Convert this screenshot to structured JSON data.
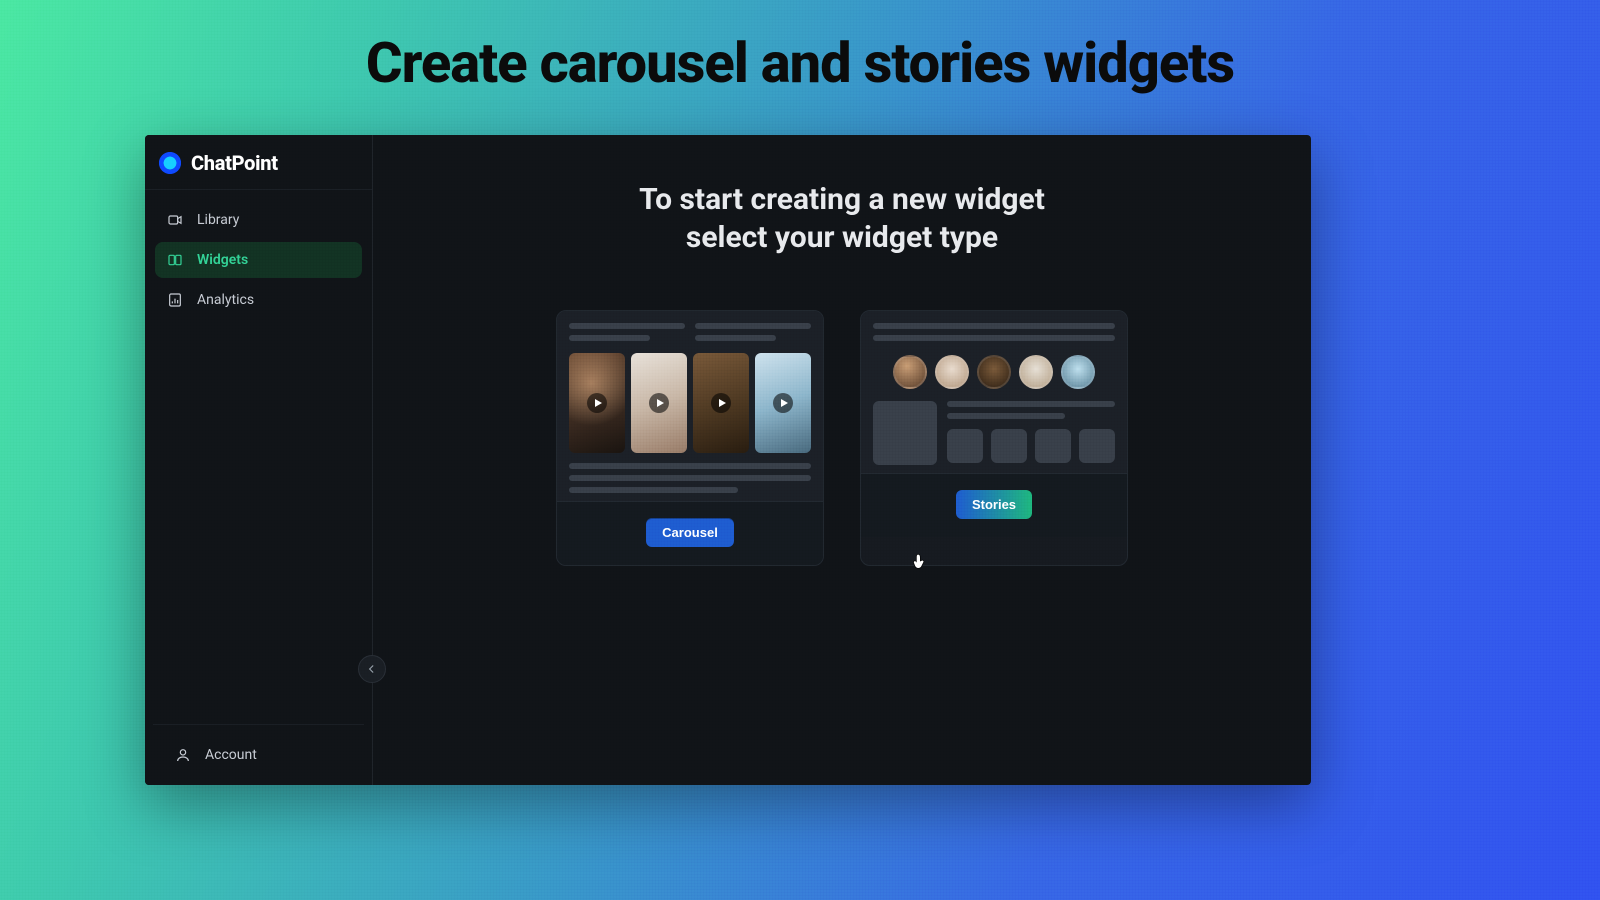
{
  "promo": {
    "title": "Create carousel and stories widgets"
  },
  "brand": {
    "name": "ChatPoint"
  },
  "sidebar": {
    "items": [
      {
        "label": "Library",
        "icon": "video-icon",
        "active": false
      },
      {
        "label": "Widgets",
        "icon": "widgets-icon",
        "active": true
      },
      {
        "label": "Analytics",
        "icon": "analytics-icon",
        "active": false
      }
    ],
    "account_label": "Account"
  },
  "main": {
    "heading_line1": "To start creating a new widget",
    "heading_line2": "select your widget type",
    "cards": {
      "carousel": {
        "button_label": "Carousel"
      },
      "stories": {
        "button_label": "Stories"
      }
    }
  },
  "colors": {
    "accent_blue": "#1f5ed1",
    "accent_green": "#22c55e",
    "bg_dark": "#111418"
  }
}
